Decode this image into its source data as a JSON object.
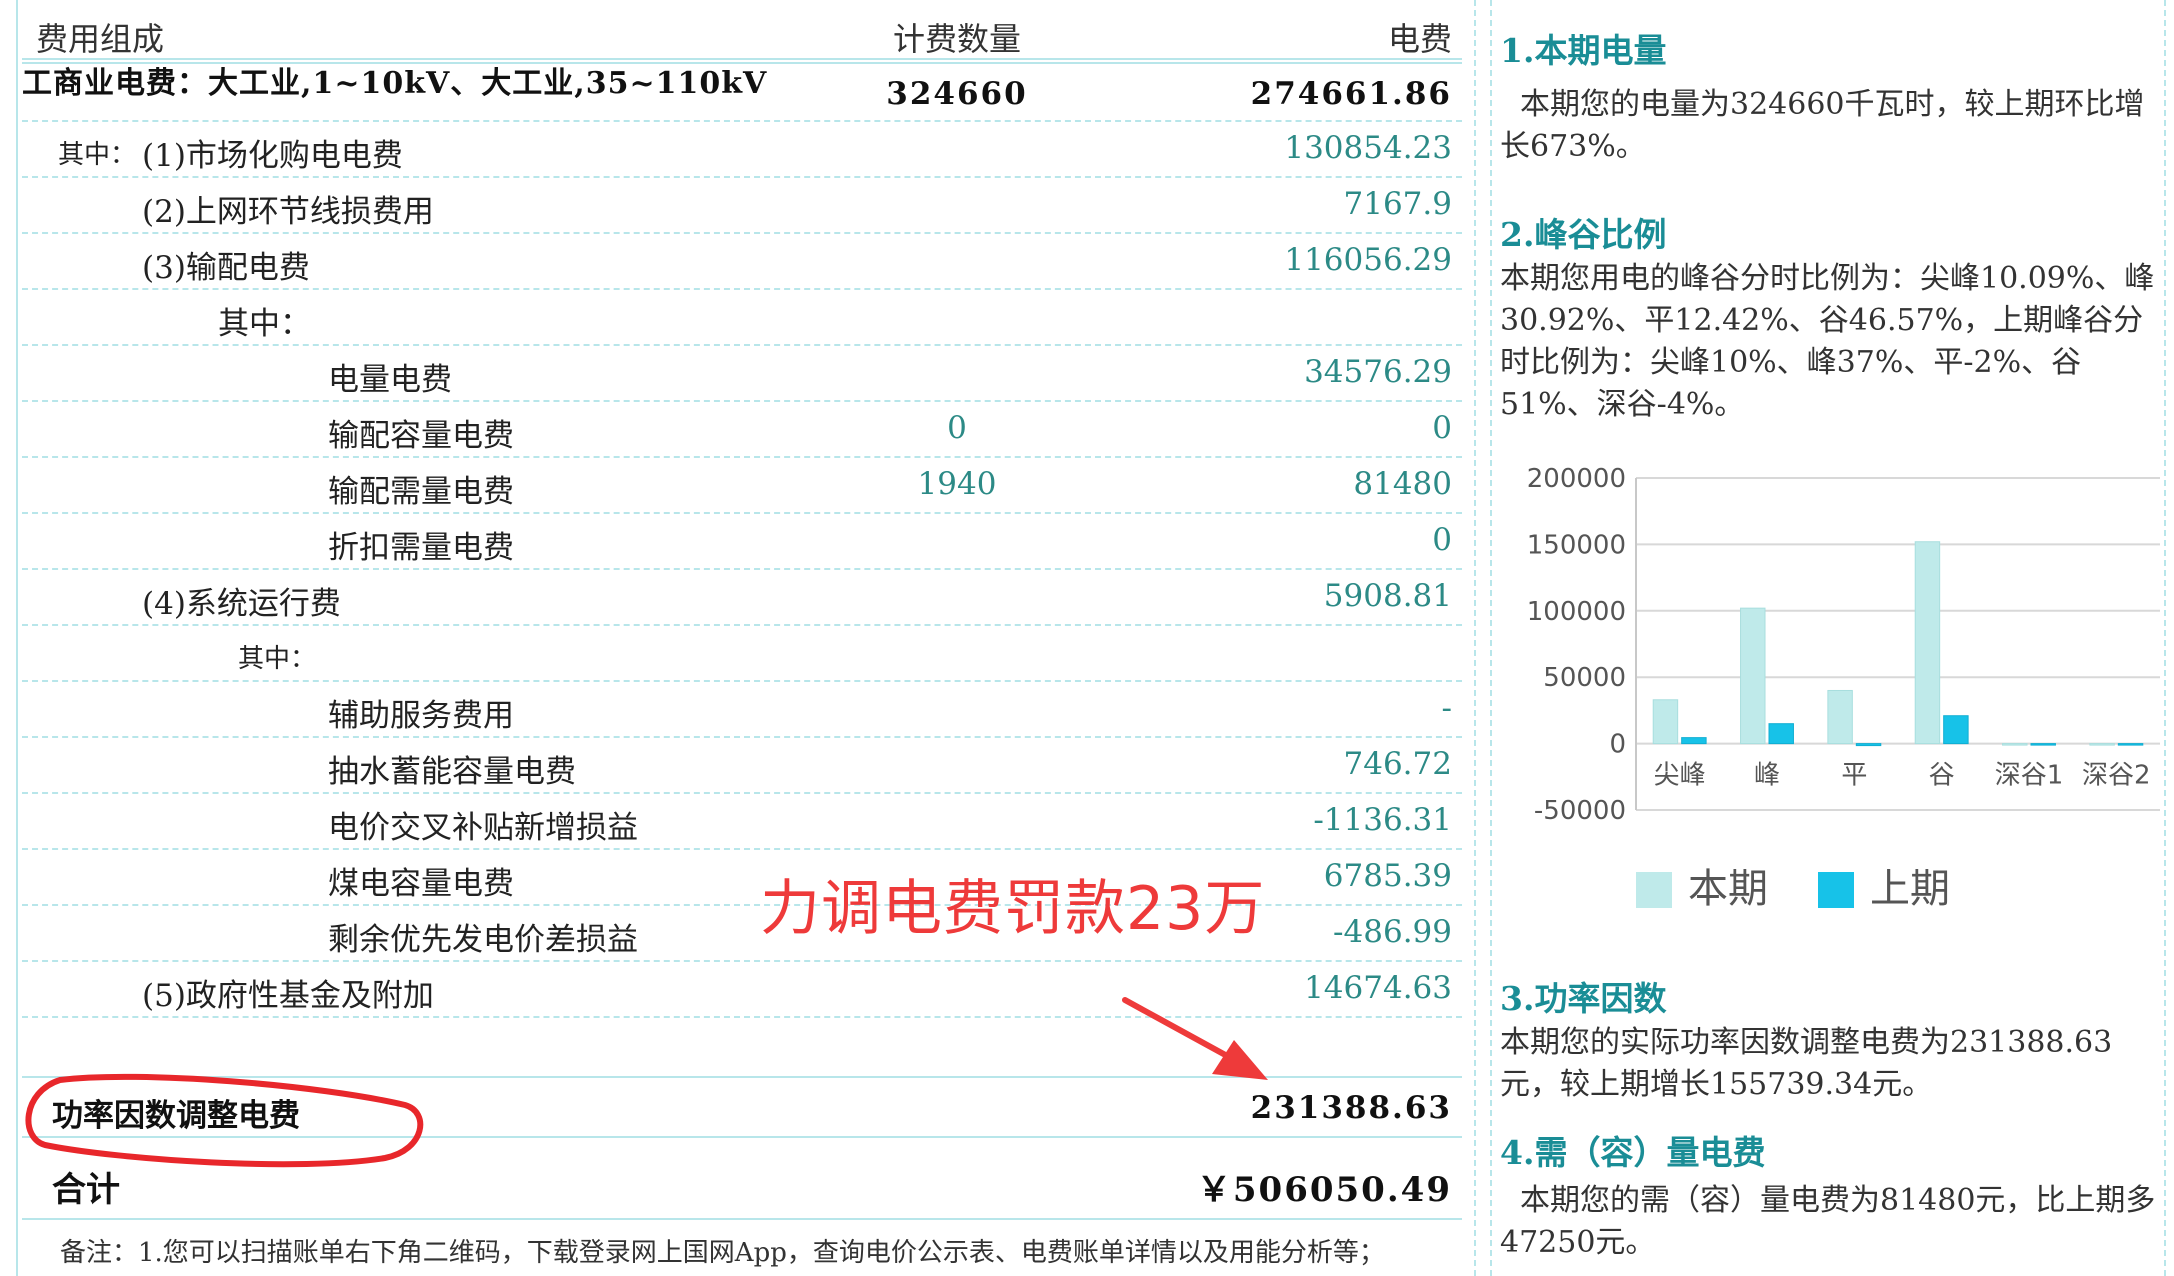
{
  "table": {
    "headers": {
      "item": "费用组成",
      "qty": "计费数量",
      "amount": "电费"
    },
    "rows": [
      {
        "label": "工商业电费：大工业,1~10kV、大工业,35~110kV",
        "qty": "324660",
        "amount": "274661.86"
      },
      {
        "prefix": "其中：",
        "label": "(1)市场化购电电费",
        "qty": "",
        "amount": "130854.23"
      },
      {
        "label": "(2)上网环节线损费用",
        "qty": "",
        "amount": "7167.9"
      },
      {
        "label": "(3)输配电费",
        "qty": "",
        "amount": "116056.29"
      },
      {
        "label": "其中：",
        "qty": "",
        "amount": ""
      },
      {
        "label": "电量电费",
        "qty": "",
        "amount": "34576.29"
      },
      {
        "label": "输配容量电费",
        "qty": "0",
        "amount": "0"
      },
      {
        "label": "输配需量电费",
        "qty": "1940",
        "amount": "81480"
      },
      {
        "label": "折扣需量电费",
        "qty": "",
        "amount": "0"
      },
      {
        "label": "(4)系统运行费",
        "qty": "",
        "amount": "5908.81"
      },
      {
        "label": "其中：",
        "qty": "",
        "amount": ""
      },
      {
        "label": "辅助服务费用",
        "qty": "",
        "amount": "-"
      },
      {
        "label": "抽水蓄能容量电费",
        "qty": "",
        "amount": "746.72"
      },
      {
        "label": "电价交叉补贴新增损益",
        "qty": "",
        "amount": "-1136.31"
      },
      {
        "label": "煤电容量电费",
        "qty": "",
        "amount": "6785.39"
      },
      {
        "label": "剩余优先发电价差损益",
        "qty": "",
        "amount": "-486.99"
      },
      {
        "label": "(5)政府性基金及附加",
        "qty": "",
        "amount": "14674.63"
      }
    ],
    "power_factor": {
      "label": "功率因数调整电费",
      "amount": "231388.63"
    },
    "total": {
      "label": "合计",
      "amount": "￥506050.49"
    },
    "note": "备注：1.您可以扫描账单右下角二维码，下载登录网上国网App，查询电价公示表、电费账单详情以及用能分析等；"
  },
  "annotation": {
    "text": "力调电费罚款23万",
    "color": "#ee3a3a"
  },
  "summary": {
    "s1": {
      "title": "1.本期电量",
      "body": "本期您的电量为324660千瓦时，较上期环比增长673%。"
    },
    "s2": {
      "title": "2.峰谷比例",
      "body": "本期您用电的峰谷分时比例为：尖峰10.09%、峰30.92%、平12.42%、谷46.57%，上期峰谷分时比例为：尖峰10%、峰37%、平-2%、谷51%、深谷-4%。"
    },
    "s3": {
      "title": "3.功率因数",
      "body": "本期您的实际功率因数调整电费为231388.63元，较上期增长155739.34元。"
    },
    "s4": {
      "title": "4.需（容）量电费",
      "body": "本期您的需（容）量电费为81480元，比上期多47250元。"
    }
  },
  "chart_data": {
    "type": "bar",
    "categories": [
      "尖峰",
      "峰",
      "平",
      "谷",
      "深谷1",
      "深谷2"
    ],
    "series": [
      {
        "name": "本期",
        "values": [
          33000,
          102000,
          40000,
          152000,
          0,
          0
        ],
        "color": "#bfeaea"
      },
      {
        "name": "上期",
        "values": [
          4500,
          15000,
          -1500,
          21000,
          0,
          -300
        ],
        "color": "#17c2e8"
      }
    ],
    "ylim": [
      -50000,
      200000
    ],
    "yticks": [
      "200000",
      "150000",
      "100000",
      "50000",
      "0",
      "-50000"
    ],
    "legend": "bottom",
    "grid": true
  }
}
